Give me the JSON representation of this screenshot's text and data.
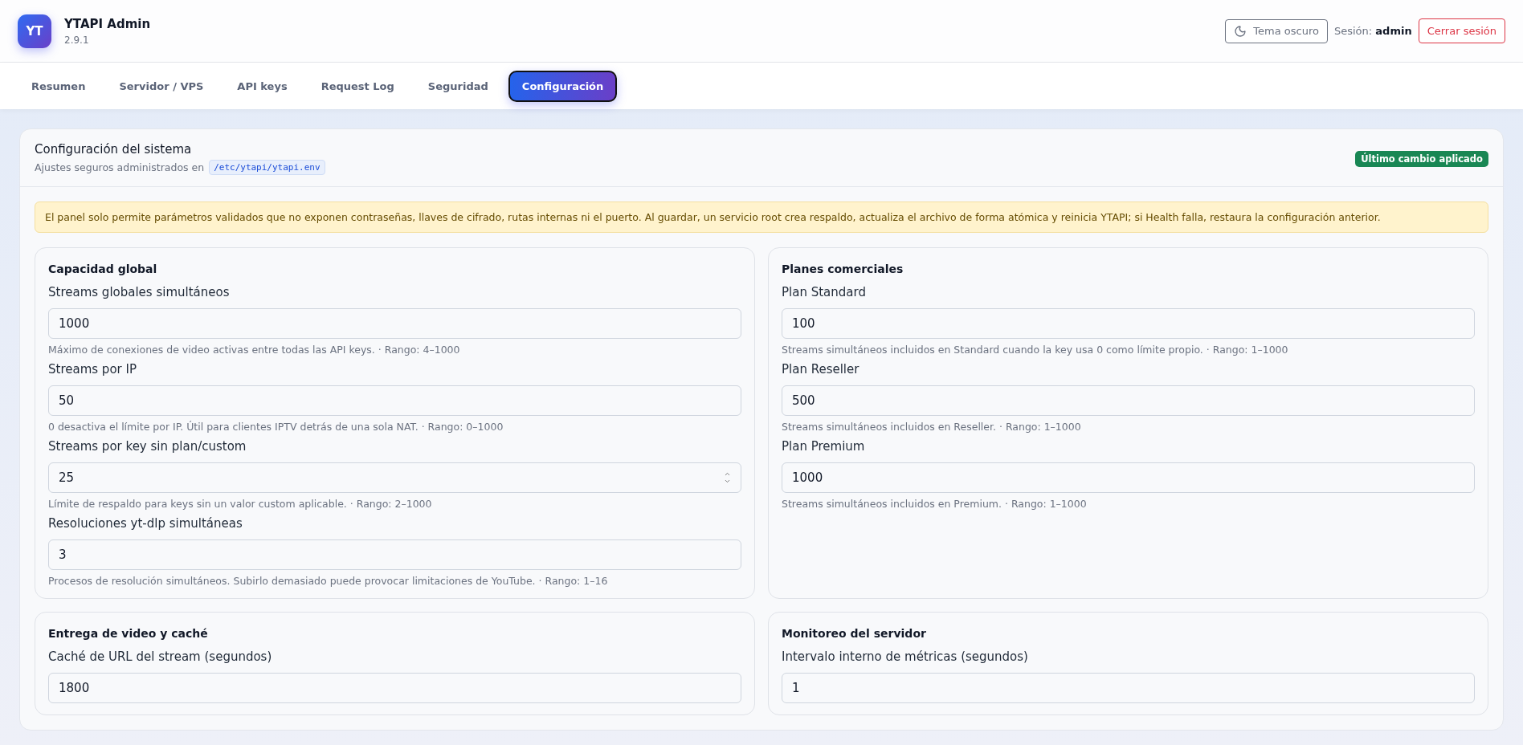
{
  "app": {
    "logo": "YT",
    "title": "YTAPI Admin",
    "version": "2.9.1"
  },
  "header_actions": {
    "theme_button": "Tema oscuro",
    "session_label": "Sesión:",
    "session_user": "admin",
    "logout_button": "Cerrar sesión"
  },
  "tabs": [
    {
      "label": "Resumen",
      "selected": false
    },
    {
      "label": "Servidor / VPS",
      "selected": false
    },
    {
      "label": "API keys",
      "selected": false
    },
    {
      "label": "Request Log",
      "selected": false
    },
    {
      "label": "Seguridad",
      "selected": false
    },
    {
      "label": "Configuración",
      "selected": true
    }
  ],
  "panel": {
    "title": "Configuración del sistema",
    "subtitle": "Ajustes seguros administrados en",
    "path": "/etc/ytapi/ytapi.env",
    "status_badge": "Último cambio aplicado",
    "notice": "El panel solo permite parámetros validados que no exponen contraseñas, llaves de cifrado, rutas internas ni el puerto. Al guardar, un servicio root crea respaldo, actualiza el archivo de forma atómica y reinicia YTAPI; si Health falla, restaura la configuración anterior.",
    "sections": [
      {
        "title": "Capacidad global",
        "fields": [
          {
            "kind": "plain",
            "label": "Streams globales simultáneos",
            "value": "1000",
            "hint": "Máximo de conexiones de video activas entre todas las API keys. · Rango: 4–1000"
          },
          {
            "kind": "plain",
            "label": "Streams por IP",
            "value": "50",
            "hint": "0 desactiva el límite por IP. Útil para clientes IPTV detrás de una sola NAT. · Rango: 0–1000"
          },
          {
            "kind": "stepper",
            "label": "Streams por key sin plan/custom",
            "value": "25",
            "hint": "Límite de respaldo para keys sin un valor custom aplicable. · Rango: 2–1000"
          },
          {
            "kind": "plain",
            "label": "Resoluciones yt-dlp simultáneas",
            "value": "3",
            "hint": "Procesos de resolución simultáneos. Subirlo demasiado puede provocar limitaciones de YouTube. · Rango: 1–16"
          }
        ]
      },
      {
        "title": "Planes comerciales",
        "fields": [
          {
            "kind": "plain",
            "label": "Plan Standard",
            "value": "100",
            "hint": "Streams simultáneos incluidos en Standard cuando la key usa 0 como límite propio. · Rango: 1–1000"
          },
          {
            "kind": "plain",
            "label": "Plan Reseller",
            "value": "500",
            "hint": "Streams simultáneos incluidos en Reseller. · Rango: 1–1000"
          },
          {
            "kind": "plain",
            "label": "Plan Premium",
            "value": "1000",
            "hint": "Streams simultáneos incluidos en Premium. · Rango: 1–1000"
          }
        ]
      },
      {
        "title": "Entrega de video y caché",
        "fields": [
          {
            "kind": "plain",
            "label": "Caché de URL del stream (segundos)",
            "value": "1800"
          }
        ]
      },
      {
        "title": "Monitoreo del servidor",
        "fields": [
          {
            "kind": "plain",
            "label": "Intervalo interno de métricas (segundos)",
            "value": "1"
          }
        ]
      }
    ]
  }
}
